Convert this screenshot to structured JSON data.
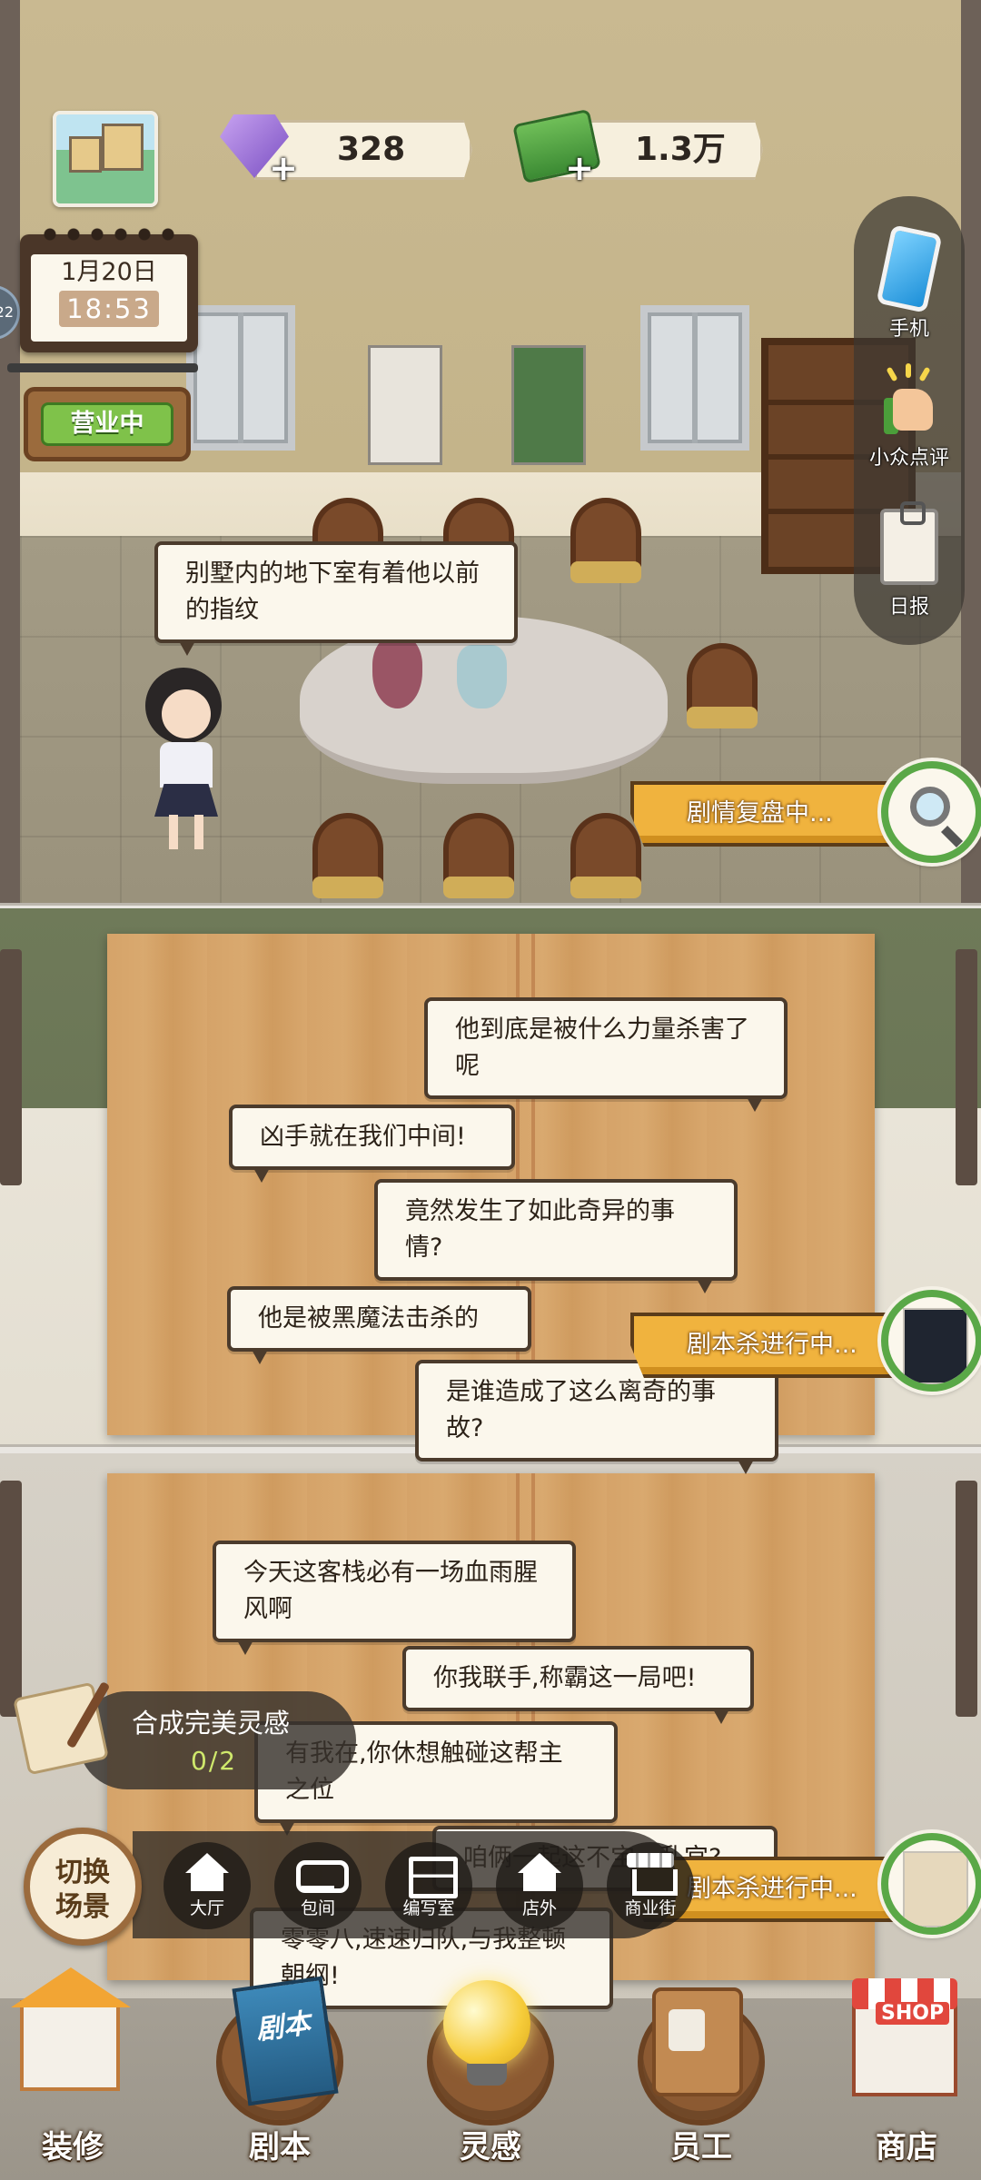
{
  "hud": {
    "gems": "328",
    "cash": "1.3万",
    "plus_symbol": "+"
  },
  "calendar": {
    "date": "1月20日",
    "time": "18:53"
  },
  "edge_badge": "22",
  "open_sign": "营业中",
  "side_menu": [
    {
      "label": "手机",
      "icon": "phone-icon"
    },
    {
      "label": "小众点评",
      "icon": "thumbs-up-icon"
    },
    {
      "label": "日报",
      "icon": "clipboard-icon"
    }
  ],
  "rooms": [
    {
      "status": "剧情复盘中...",
      "icon": "magnifier-book-icon"
    },
    {
      "status": "剧本杀进行中...",
      "icon": "script-book-icon"
    },
    {
      "status": "剧本杀进行中...",
      "icon": "script-book-icon"
    }
  ],
  "bubbles": {
    "hall": [
      "别墅内的地下室有着他以前的指纹"
    ],
    "room2": [
      "他到底是被什么力量杀害了呢",
      "凶手就在我们中间!",
      "竟然发生了如此奇异的事情?",
      "他是被黑魔法击杀的",
      "是谁造成了这么离奇的事故?"
    ],
    "room3": [
      "今天这客栈必有一场血雨腥风啊",
      "你我联手,称霸这一局吧!",
      "有我在,你休想触碰这帮主之位",
      "咱俩一起这不宝…乱宫?",
      "零零八,速速归队,与我整顿朝纲!"
    ]
  },
  "task": {
    "title": "合成完美灵感",
    "progress": "0/2"
  },
  "scene_switch": {
    "button": "切换场景",
    "tabs": [
      {
        "label": "大厅",
        "icon": "hall-icon"
      },
      {
        "label": "包间",
        "icon": "sofa-icon"
      },
      {
        "label": "编写室",
        "icon": "desk-icon"
      },
      {
        "label": "店外",
        "icon": "house-icon"
      },
      {
        "label": "商业街",
        "icon": "shop-street-icon"
      }
    ]
  },
  "bottom_nav": [
    {
      "label": "装修",
      "icon": "decorate-house-icon"
    },
    {
      "label": "剧本",
      "icon": "script-book-icon",
      "art_text": "剧本"
    },
    {
      "label": "灵感",
      "icon": "lightbulb-icon"
    },
    {
      "label": "员工",
      "icon": "staff-badge-icon"
    },
    {
      "label": "商店",
      "icon": "shop-icon",
      "art_text": "SHOP"
    }
  ],
  "colors": {
    "status_banner": "#f0b33e",
    "open_sign": "#7fc24a",
    "ring_green": "#5aa847"
  }
}
